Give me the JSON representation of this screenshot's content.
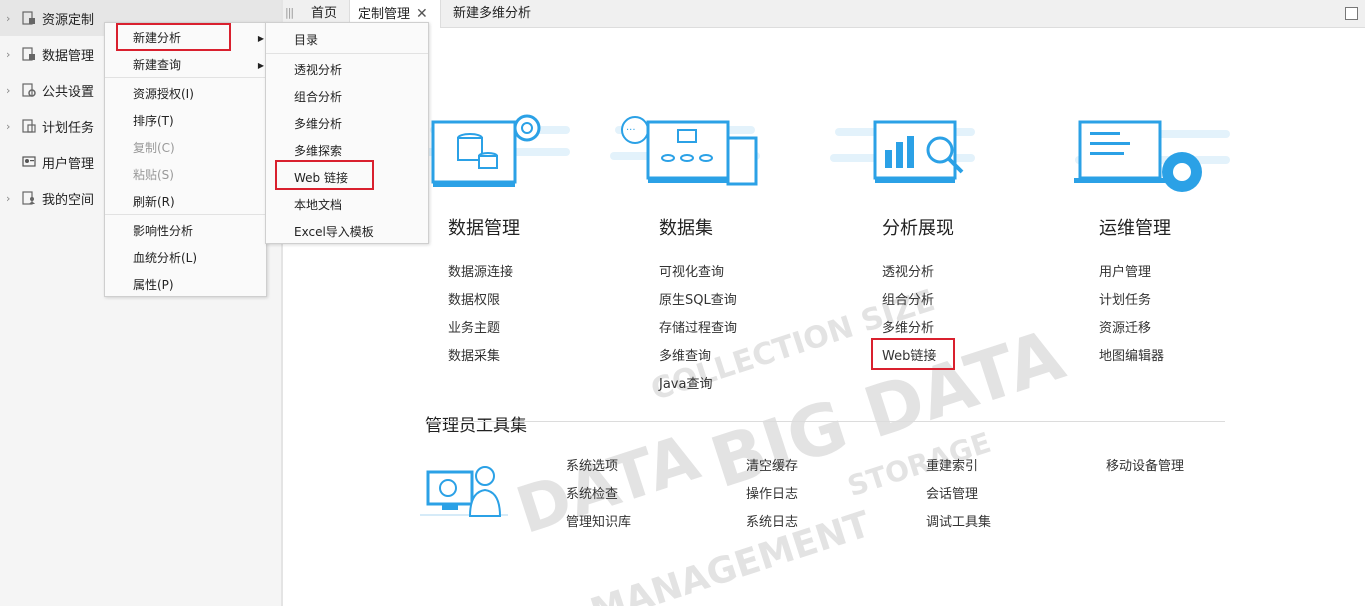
{
  "sidebar": {
    "items": [
      {
        "label": "资源定制",
        "icon": "folder-list-icon",
        "has_arrow": true
      },
      {
        "label": "数据管理",
        "icon": "folder-list-icon",
        "has_arrow": true
      },
      {
        "label": "公共设置",
        "icon": "gear-doc-icon",
        "has_arrow": true
      },
      {
        "label": "计划任务",
        "icon": "schedule-doc-icon",
        "has_arrow": true
      },
      {
        "label": "用户管理",
        "icon": "user-group-icon",
        "has_arrow": false
      },
      {
        "label": "我的空间",
        "icon": "user-doc-icon",
        "has_arrow": true
      }
    ]
  },
  "tabs": [
    {
      "label": "首页"
    },
    {
      "label": "定制管理"
    },
    {
      "label": "新建多维分析"
    }
  ],
  "context_menu": {
    "items": [
      {
        "label": "新建分析"
      },
      {
        "label": "新建查询"
      },
      {
        "label": "资源授权(I)"
      },
      {
        "label": "排序(T)"
      },
      {
        "label": "复制(C)"
      },
      {
        "label": "粘贴(S)"
      },
      {
        "label": "刷新(R)"
      },
      {
        "label": "影响性分析"
      },
      {
        "label": "血统分析(L)"
      },
      {
        "label": "属性(P)"
      }
    ]
  },
  "submenu": {
    "items": [
      {
        "label": "目录"
      },
      {
        "label": "透视分析"
      },
      {
        "label": "组合分析"
      },
      {
        "label": "多维分析"
      },
      {
        "label": "多维探索"
      },
      {
        "label": "Web 链接"
      },
      {
        "label": "本地文档"
      },
      {
        "label": "Excel导入模板"
      }
    ]
  },
  "cards": [
    {
      "title": "数据管理",
      "links": [
        "数据源连接",
        "数据权限",
        "业务主题",
        "数据采集"
      ]
    },
    {
      "title": "数据集",
      "links": [
        "可视化查询",
        "原生SQL查询",
        "存储过程查询",
        "多维查询",
        "Java查询"
      ]
    },
    {
      "title": "分析展现",
      "links": [
        "透视分析",
        "组合分析",
        "多维分析",
        "Web链接"
      ]
    },
    {
      "title": "运维管理",
      "links": [
        "用户管理",
        "计划任务",
        "资源迁移",
        "地图编辑器"
      ]
    }
  ],
  "admin_tools": {
    "title": "管理员工具集",
    "columns": [
      [
        "系统选项",
        "系统检查",
        "管理知识库"
      ],
      [
        "清空缓存",
        "操作日志",
        "系统日志"
      ],
      [
        "重建索引",
        "会话管理",
        "调试工具集"
      ],
      [
        "移动设备管理"
      ]
    ]
  },
  "colors": {
    "accent_blue": "#2ba1e6",
    "highlight_red": "#d9202e",
    "sidebar_bg": "#f5f5f5"
  }
}
